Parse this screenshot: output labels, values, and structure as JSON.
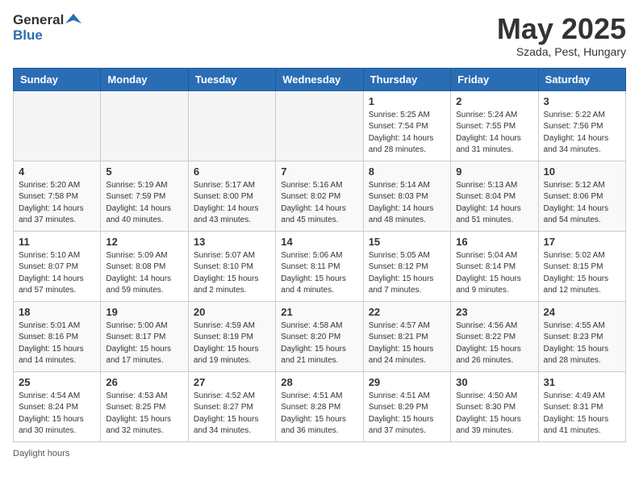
{
  "header": {
    "logo_general": "General",
    "logo_blue": "Blue",
    "title": "May 2025",
    "subtitle": "Szada, Pest, Hungary"
  },
  "weekdays": [
    "Sunday",
    "Monday",
    "Tuesday",
    "Wednesday",
    "Thursday",
    "Friday",
    "Saturday"
  ],
  "footer": "Daylight hours",
  "weeks": [
    [
      {
        "day": "",
        "empty": true
      },
      {
        "day": "",
        "empty": true
      },
      {
        "day": "",
        "empty": true
      },
      {
        "day": "",
        "empty": true
      },
      {
        "day": "1",
        "sunrise": "Sunrise: 5:25 AM",
        "sunset": "Sunset: 7:54 PM",
        "daylight": "Daylight: 14 hours and 28 minutes."
      },
      {
        "day": "2",
        "sunrise": "Sunrise: 5:24 AM",
        "sunset": "Sunset: 7:55 PM",
        "daylight": "Daylight: 14 hours and 31 minutes."
      },
      {
        "day": "3",
        "sunrise": "Sunrise: 5:22 AM",
        "sunset": "Sunset: 7:56 PM",
        "daylight": "Daylight: 14 hours and 34 minutes."
      }
    ],
    [
      {
        "day": "4",
        "sunrise": "Sunrise: 5:20 AM",
        "sunset": "Sunset: 7:58 PM",
        "daylight": "Daylight: 14 hours and 37 minutes."
      },
      {
        "day": "5",
        "sunrise": "Sunrise: 5:19 AM",
        "sunset": "Sunset: 7:59 PM",
        "daylight": "Daylight: 14 hours and 40 minutes."
      },
      {
        "day": "6",
        "sunrise": "Sunrise: 5:17 AM",
        "sunset": "Sunset: 8:00 PM",
        "daylight": "Daylight: 14 hours and 43 minutes."
      },
      {
        "day": "7",
        "sunrise": "Sunrise: 5:16 AM",
        "sunset": "Sunset: 8:02 PM",
        "daylight": "Daylight: 14 hours and 45 minutes."
      },
      {
        "day": "8",
        "sunrise": "Sunrise: 5:14 AM",
        "sunset": "Sunset: 8:03 PM",
        "daylight": "Daylight: 14 hours and 48 minutes."
      },
      {
        "day": "9",
        "sunrise": "Sunrise: 5:13 AM",
        "sunset": "Sunset: 8:04 PM",
        "daylight": "Daylight: 14 hours and 51 minutes."
      },
      {
        "day": "10",
        "sunrise": "Sunrise: 5:12 AM",
        "sunset": "Sunset: 8:06 PM",
        "daylight": "Daylight: 14 hours and 54 minutes."
      }
    ],
    [
      {
        "day": "11",
        "sunrise": "Sunrise: 5:10 AM",
        "sunset": "Sunset: 8:07 PM",
        "daylight": "Daylight: 14 hours and 57 minutes."
      },
      {
        "day": "12",
        "sunrise": "Sunrise: 5:09 AM",
        "sunset": "Sunset: 8:08 PM",
        "daylight": "Daylight: 14 hours and 59 minutes."
      },
      {
        "day": "13",
        "sunrise": "Sunrise: 5:07 AM",
        "sunset": "Sunset: 8:10 PM",
        "daylight": "Daylight: 15 hours and 2 minutes."
      },
      {
        "day": "14",
        "sunrise": "Sunrise: 5:06 AM",
        "sunset": "Sunset: 8:11 PM",
        "daylight": "Daylight: 15 hours and 4 minutes."
      },
      {
        "day": "15",
        "sunrise": "Sunrise: 5:05 AM",
        "sunset": "Sunset: 8:12 PM",
        "daylight": "Daylight: 15 hours and 7 minutes."
      },
      {
        "day": "16",
        "sunrise": "Sunrise: 5:04 AM",
        "sunset": "Sunset: 8:14 PM",
        "daylight": "Daylight: 15 hours and 9 minutes."
      },
      {
        "day": "17",
        "sunrise": "Sunrise: 5:02 AM",
        "sunset": "Sunset: 8:15 PM",
        "daylight": "Daylight: 15 hours and 12 minutes."
      }
    ],
    [
      {
        "day": "18",
        "sunrise": "Sunrise: 5:01 AM",
        "sunset": "Sunset: 8:16 PM",
        "daylight": "Daylight: 15 hours and 14 minutes."
      },
      {
        "day": "19",
        "sunrise": "Sunrise: 5:00 AM",
        "sunset": "Sunset: 8:17 PM",
        "daylight": "Daylight: 15 hours and 17 minutes."
      },
      {
        "day": "20",
        "sunrise": "Sunrise: 4:59 AM",
        "sunset": "Sunset: 8:19 PM",
        "daylight": "Daylight: 15 hours and 19 minutes."
      },
      {
        "day": "21",
        "sunrise": "Sunrise: 4:58 AM",
        "sunset": "Sunset: 8:20 PM",
        "daylight": "Daylight: 15 hours and 21 minutes."
      },
      {
        "day": "22",
        "sunrise": "Sunrise: 4:57 AM",
        "sunset": "Sunset: 8:21 PM",
        "daylight": "Daylight: 15 hours and 24 minutes."
      },
      {
        "day": "23",
        "sunrise": "Sunrise: 4:56 AM",
        "sunset": "Sunset: 8:22 PM",
        "daylight": "Daylight: 15 hours and 26 minutes."
      },
      {
        "day": "24",
        "sunrise": "Sunrise: 4:55 AM",
        "sunset": "Sunset: 8:23 PM",
        "daylight": "Daylight: 15 hours and 28 minutes."
      }
    ],
    [
      {
        "day": "25",
        "sunrise": "Sunrise: 4:54 AM",
        "sunset": "Sunset: 8:24 PM",
        "daylight": "Daylight: 15 hours and 30 minutes."
      },
      {
        "day": "26",
        "sunrise": "Sunrise: 4:53 AM",
        "sunset": "Sunset: 8:25 PM",
        "daylight": "Daylight: 15 hours and 32 minutes."
      },
      {
        "day": "27",
        "sunrise": "Sunrise: 4:52 AM",
        "sunset": "Sunset: 8:27 PM",
        "daylight": "Daylight: 15 hours and 34 minutes."
      },
      {
        "day": "28",
        "sunrise": "Sunrise: 4:51 AM",
        "sunset": "Sunset: 8:28 PM",
        "daylight": "Daylight: 15 hours and 36 minutes."
      },
      {
        "day": "29",
        "sunrise": "Sunrise: 4:51 AM",
        "sunset": "Sunset: 8:29 PM",
        "daylight": "Daylight: 15 hours and 37 minutes."
      },
      {
        "day": "30",
        "sunrise": "Sunrise: 4:50 AM",
        "sunset": "Sunset: 8:30 PM",
        "daylight": "Daylight: 15 hours and 39 minutes."
      },
      {
        "day": "31",
        "sunrise": "Sunrise: 4:49 AM",
        "sunset": "Sunset: 8:31 PM",
        "daylight": "Daylight: 15 hours and 41 minutes."
      }
    ]
  ]
}
